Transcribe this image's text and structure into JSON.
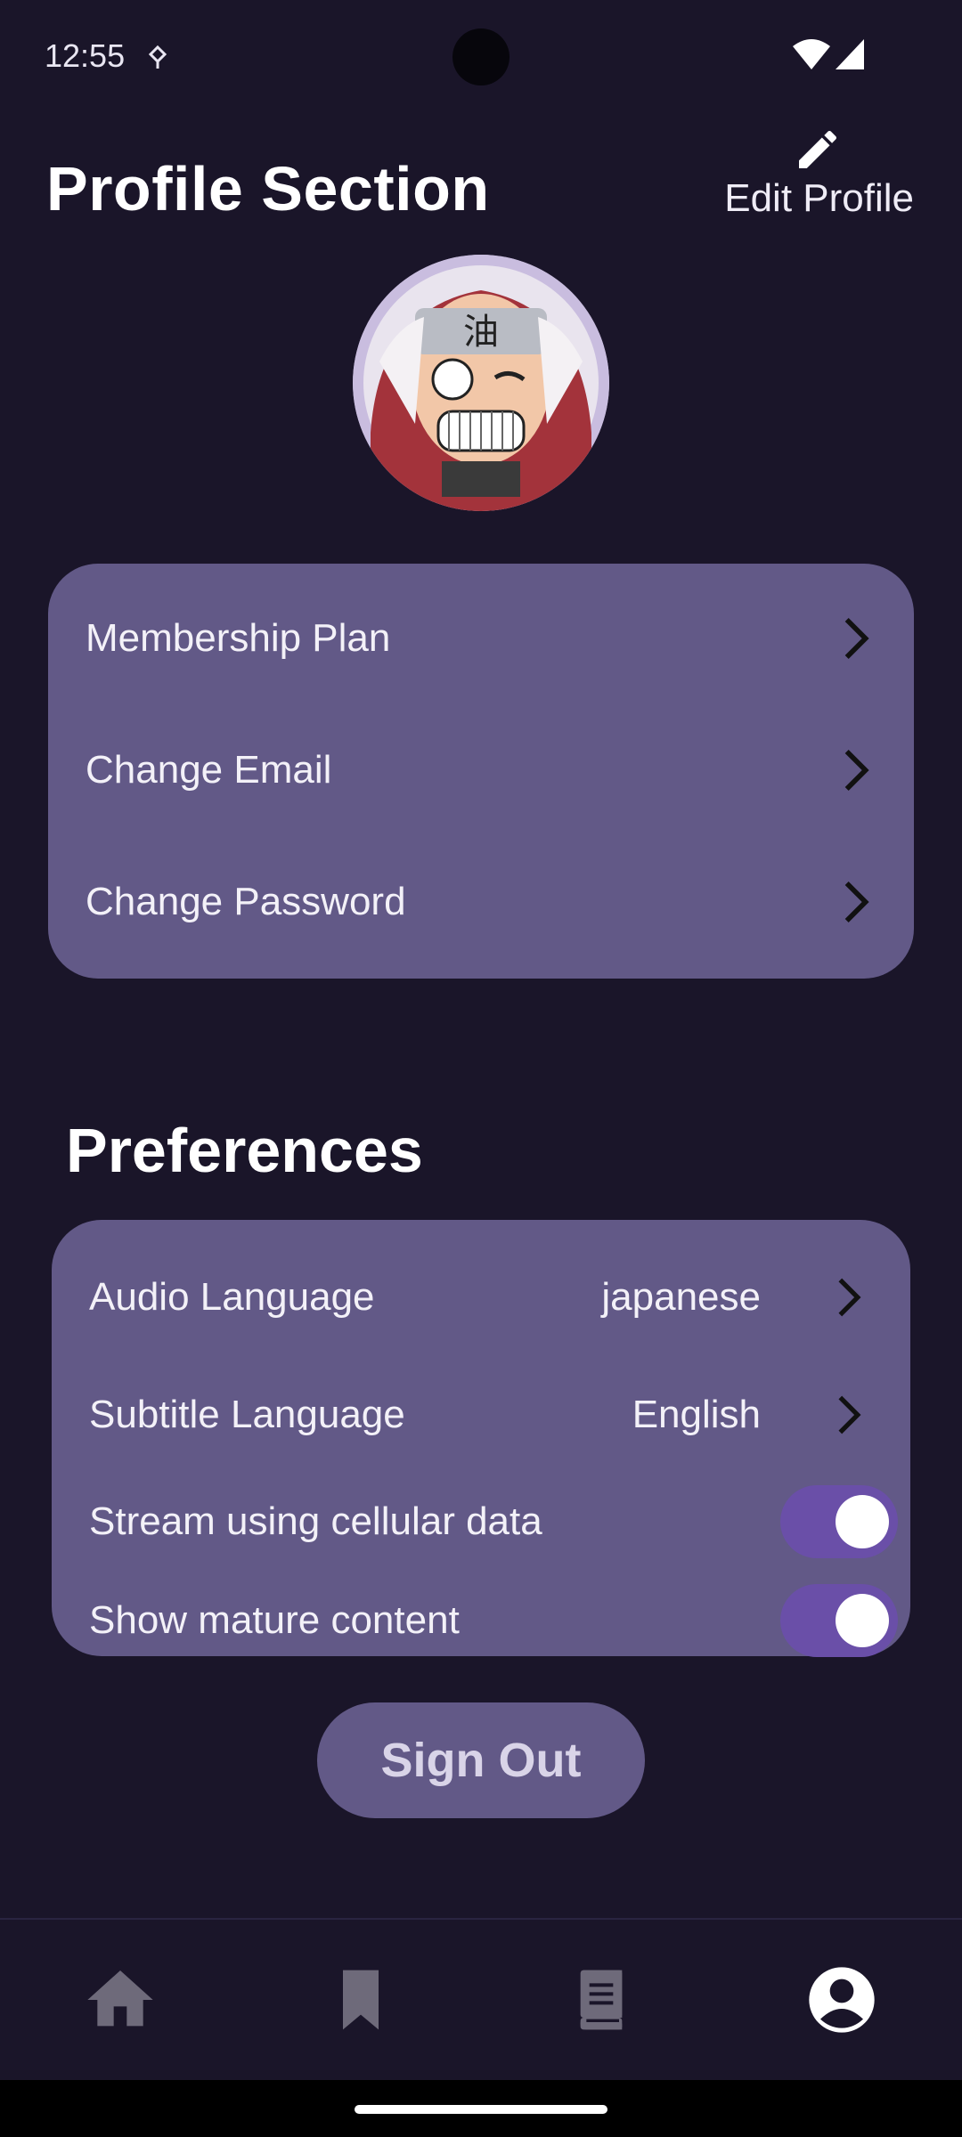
{
  "status_bar": {
    "time": "12:55"
  },
  "header": {
    "title": "Profile Section",
    "edit_label": "Edit Profile",
    "edit_icon": "pencil-icon"
  },
  "account_menu": {
    "items": [
      {
        "label": "Membership Plan"
      },
      {
        "label": "Change Email"
      },
      {
        "label": "Change Password"
      }
    ]
  },
  "preferences": {
    "title": "Preferences",
    "audio_language": {
      "label": "Audio Language",
      "value": "japanese"
    },
    "subtitle_language": {
      "label": "Subtitle Language",
      "value": "English"
    },
    "cellular": {
      "label": "Stream using cellular data",
      "enabled": true
    },
    "mature": {
      "label": "Show mature content",
      "enabled": true
    }
  },
  "sign_out_label": "Sign Out",
  "bottom_nav": {
    "items": [
      {
        "icon": "home-icon",
        "active": false
      },
      {
        "icon": "bookmark-icon",
        "active": false
      },
      {
        "icon": "book-icon",
        "active": false
      },
      {
        "icon": "account-circle-icon",
        "active": true
      }
    ]
  },
  "colors": {
    "background": "#1a1529",
    "card": "#625987",
    "toggle_on": "#6a4fa8",
    "nav_inactive": "#6e6a7a",
    "nav_active": "#ffffff"
  }
}
